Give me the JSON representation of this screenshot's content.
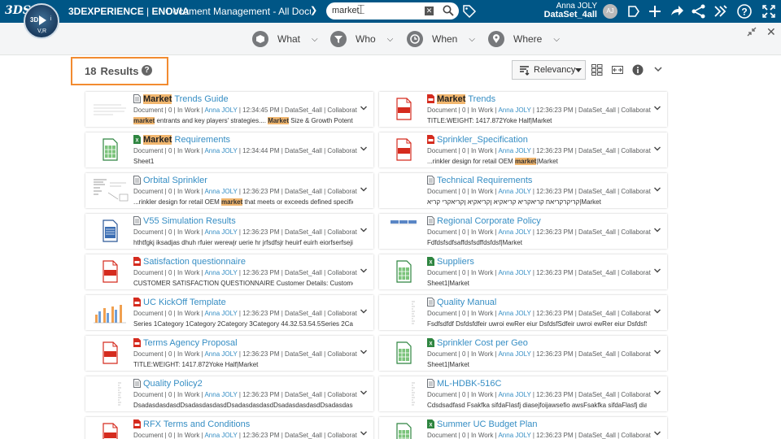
{
  "topbar": {
    "ds_logo": "3DS",
    "brand_3dx": "3DEXPERIENCE",
    "brand_sep": " | ",
    "brand_app": "ENOVIA",
    "app_title": "Document Management - All Docume...",
    "compass_3d": "3D",
    "compass_vr": "V,R",
    "compass_i": "i",
    "search_value": "market",
    "user_name": "Anna JOLY",
    "dataset": "DataSet_4all",
    "avatar_initials": "AJ"
  },
  "filters": [
    {
      "label": "What"
    },
    {
      "label": "Who"
    },
    {
      "label": "When"
    },
    {
      "label": "Where"
    }
  ],
  "results": {
    "count": "18",
    "label": "Results",
    "sort_label": "Relevancy"
  },
  "meta_prefix": "Document | 0 | In Work | ",
  "meta_suffix": " | DataSet_4all | Collaborative Spa...",
  "owner": "Anna JOLY",
  "cards_left": [
    {
      "pre": "",
      "hl": "Market",
      "post": " Trends Guide",
      "time": "12:34:45 PM",
      "type": "doc",
      "thumb": "page",
      "snip": [
        {
          "b": "market"
        },
        {
          "t": " entrants and key players' strategies.... "
        },
        {
          "b": "Market"
        },
        {
          "t": " Size & Growth Potential: How big"
        }
      ]
    },
    {
      "pre": "",
      "hl": "Market",
      "post": " Requirements",
      "time": "12:34:44 PM",
      "type": "xls",
      "thumb": "xls",
      "snip": [
        {
          "t": "Sheet1"
        }
      ]
    },
    {
      "pre": "Orbital Sprinkler",
      "hl": "",
      "post": "",
      "time": "12:36:23 PM",
      "type": "doc",
      "thumb": "drawing",
      "snip": [
        {
          "t": "...rinkler design for retail OEM "
        },
        {
          "b": "market"
        },
        {
          "t": " that meets or exceeds defined specifications.|Mark"
        }
      ]
    },
    {
      "pre": "V55 Simulation Results",
      "hl": "",
      "post": "",
      "time": "12:36:23 PM",
      "type": "doc",
      "thumb": "docicon",
      "snip": [
        {
          "t": "hthtfgkj iksadjas dhuh rfuier werewjr uerie hr jrfsdfsjr heuirf euirh eiorfserfsejirh uerioerf i"
        }
      ]
    },
    {
      "pre": "Satisfaction questionnaire",
      "hl": "",
      "post": "",
      "time": "12:36:23 PM",
      "type": "pdf",
      "thumb": "pdf",
      "snip": [
        {
          "t": "CUSTOMER SATISFACTION QUESTIONNAIRE Customer Details: Customer Name: Cu"
        }
      ]
    },
    {
      "pre": "UC KickOff Template",
      "hl": "",
      "post": "",
      "time": "12:36:23 PM",
      "type": "pdf",
      "thumb": "chart",
      "snip": [
        {
          "t": "Series 1Category 1Category 2Category 3Category 44.32.53.54.5Series 2Category 1Cate"
        }
      ]
    },
    {
      "pre": "Terms Agency Proposal",
      "hl": "",
      "post": "",
      "time": "12:36:23 PM",
      "type": "pdf",
      "thumb": "pdf",
      "snip": [
        {
          "t": "TITLE:WEIGHT: 1417.872Yoke Half|Market"
        }
      ]
    },
    {
      "pre": "Quality Policy2",
      "hl": "",
      "post": "",
      "time": "12:36:23 PM",
      "type": "doc",
      "thumb": "lines",
      "snip": [
        {
          "t": "DsadasdasdasdDsadasdasdasdDsadasdasdasdDsadasdasdasdDsadasdasdasdDsadas"
        }
      ]
    },
    {
      "pre": "RFX Terms and Conditions",
      "hl": "",
      "post": "",
      "time": "12:36:23 PM",
      "type": "pdf",
      "thumb": "pdf",
      "snip": [
        {
          "t": ""
        }
      ]
    }
  ],
  "cards_right": [
    {
      "pre": "",
      "hl": "Market",
      "post": " Trends",
      "time": "12:36:23 PM",
      "type": "pdf",
      "thumb": "pdf",
      "snip": [
        {
          "t": "TITLE:WEIGHT: 1417.872Yoke Half|Market"
        }
      ]
    },
    {
      "pre": "Sprinkler_Specification",
      "hl": "",
      "post": "",
      "time": "12:36:23 PM",
      "type": "pdf",
      "thumb": "pdf",
      "snip": [
        {
          "t": "...rinkler design for retail OEM "
        },
        {
          "b": "market"
        },
        {
          "t": "|Market"
        }
      ]
    },
    {
      "pre": "Technical Requirements",
      "hl": "",
      "post": "",
      "time": "12:36:23 PM",
      "type": "doc",
      "thumb": "blank",
      "snip": [
        {
          "t": "קריקרקריאח קריאקריא קריאקיא ןקריאקיא ןקריאקרי קריא|Market"
        }
      ]
    },
    {
      "pre": "Regional Corporate Policy",
      "hl": "",
      "post": "",
      "time": "12:36:23 PM",
      "type": "doc",
      "thumb": "table",
      "snip": [
        {
          "t": "Fdfdsfsdfsaffdsfsdffdsfdsf|Market"
        }
      ]
    },
    {
      "pre": "Suppliers",
      "hl": "",
      "post": "",
      "time": "12:36:23 PM",
      "type": "xls",
      "thumb": "xls",
      "snip": [
        {
          "t": "Sheet1|Market"
        }
      ]
    },
    {
      "pre": "Quality Manual",
      "hl": "",
      "post": "",
      "time": "12:36:23 PM",
      "type": "doc",
      "thumb": "lines",
      "snip": [
        {
          "t": "Fsdfsdfdf Dsfdsfdfeir uwroi ewRer eiur DsfdsfSdfeir uwroi ewRer eiur DsfdsfSdfeir uwro"
        }
      ]
    },
    {
      "pre": "Sprinkler Cost per Geo",
      "hl": "",
      "post": "",
      "time": "12:36:23 PM",
      "type": "xls",
      "thumb": "xls",
      "snip": [
        {
          "t": "Sheet1|Market"
        }
      ]
    },
    {
      "pre": "ML-HDBK-516C",
      "hl": "",
      "post": "",
      "time": "12:36:23 PM",
      "type": "doc",
      "thumb": "lines",
      "snip": [
        {
          "t": "Cdsdsadfasd Fsakfka sifdaFlasfj diasejfoijawsefio awsFsakfka sifdaFlasfj diasejfoijawsef"
        }
      ]
    },
    {
      "pre": "Summer UC Budget Plan",
      "hl": "",
      "post": "",
      "time": "12:36:23 PM",
      "type": "xls",
      "thumb": "xls",
      "snip": [
        {
          "t": ""
        }
      ]
    }
  ],
  "colors": {
    "topbar": "#005686",
    "link": "#368ec4",
    "highlight": "#f1b66e",
    "results_outline": "#f28b30",
    "pdf_red": "#d52b1e",
    "xls_green": "#2e8540"
  }
}
